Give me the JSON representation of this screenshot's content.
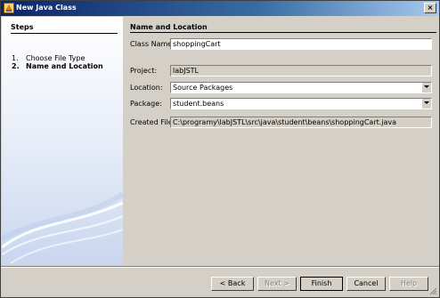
{
  "window": {
    "title": "New Java Class"
  },
  "steps": {
    "heading": "Steps",
    "items": [
      {
        "num": "1.",
        "label": "Choose File Type"
      },
      {
        "num": "2.",
        "label": "Name and Location"
      }
    ]
  },
  "form": {
    "heading": "Name and Location",
    "class_name": {
      "label": "Class Name:",
      "value": "shoppingCart"
    },
    "project": {
      "label": "Project:",
      "value": "labJSTL"
    },
    "location": {
      "label": "Location:",
      "value": "Source Packages"
    },
    "package": {
      "label": "Package:",
      "value": "student.beans"
    },
    "created_file": {
      "label": "Created File:",
      "value": "C:\\programy\\labJSTL\\src\\java\\student\\beans\\shoppingCart.java"
    }
  },
  "buttons": {
    "back": "< Back",
    "next": "Next >",
    "finish": "Finish",
    "cancel": "Cancel",
    "help": "Help"
  },
  "colors": {
    "title_start": "#0a246a",
    "title_end": "#a6caf0",
    "face": "#d4d0c8"
  }
}
